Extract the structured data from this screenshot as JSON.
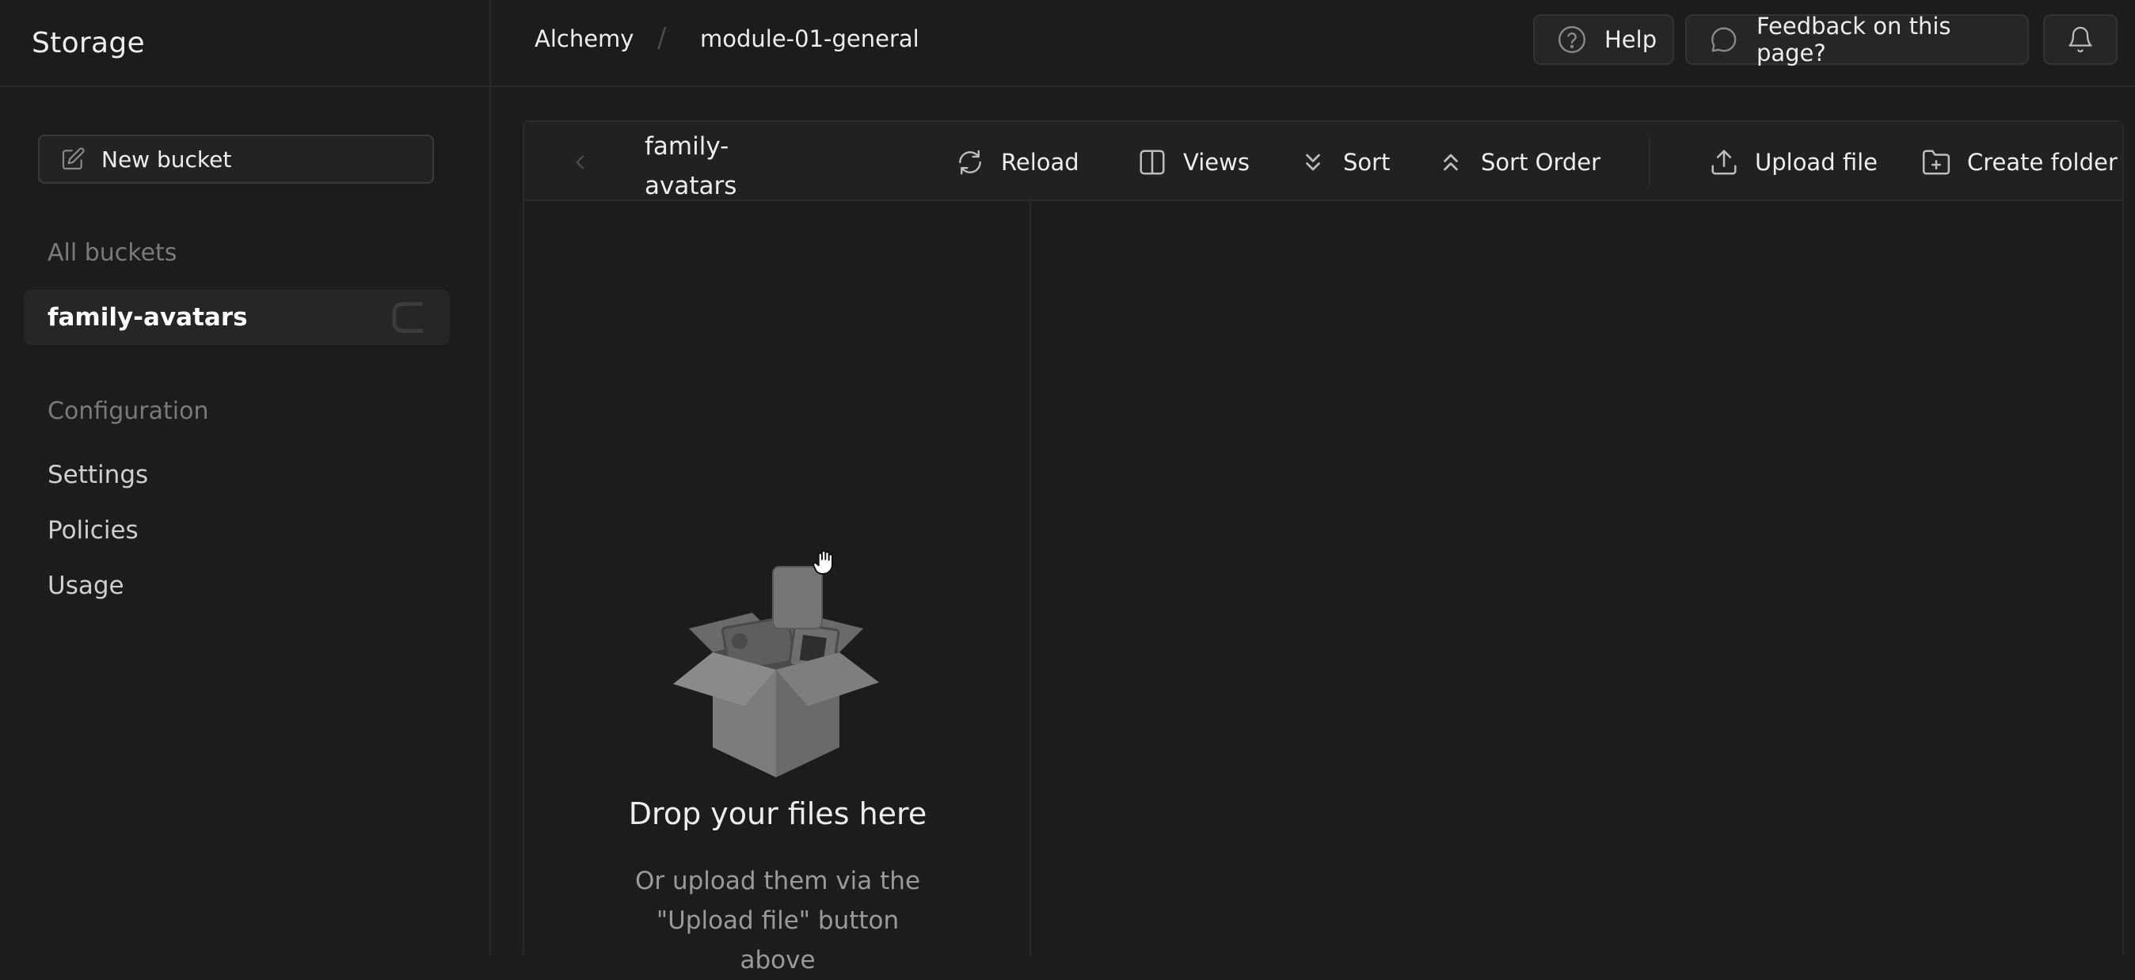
{
  "sidebar": {
    "title": "Storage",
    "new_bucket_label": "New bucket",
    "all_buckets_label": "All buckets",
    "buckets": [
      {
        "name": "family-avatars"
      }
    ],
    "configuration_label": "Configuration",
    "config_items": [
      {
        "label": "Settings"
      },
      {
        "label": "Policies"
      },
      {
        "label": "Usage"
      }
    ]
  },
  "topbar": {
    "breadcrumb": {
      "org": "Alchemy",
      "project": "module-01-general"
    },
    "help_label": "Help",
    "feedback_label": "Feedback on this page?"
  },
  "explorer": {
    "bucket_title_line1": "family-",
    "bucket_title_line2": "avatars",
    "toolbar": {
      "reload": "Reload",
      "views": "Views",
      "sort": "Sort",
      "sort_order": "Sort Order",
      "upload_file": "Upload file",
      "create_folder": "Create folder"
    },
    "empty_state": {
      "title": "Drop your files here",
      "subtitle_line1": "Or upload them via the",
      "subtitle_line2": "\"Upload file\" button",
      "subtitle_line3": "above"
    }
  },
  "colors": {
    "background": "#1c1c1c",
    "panel": "#212121",
    "border": "#2a2a2a",
    "text": "#ededed",
    "muted": "#7a7a7a"
  }
}
